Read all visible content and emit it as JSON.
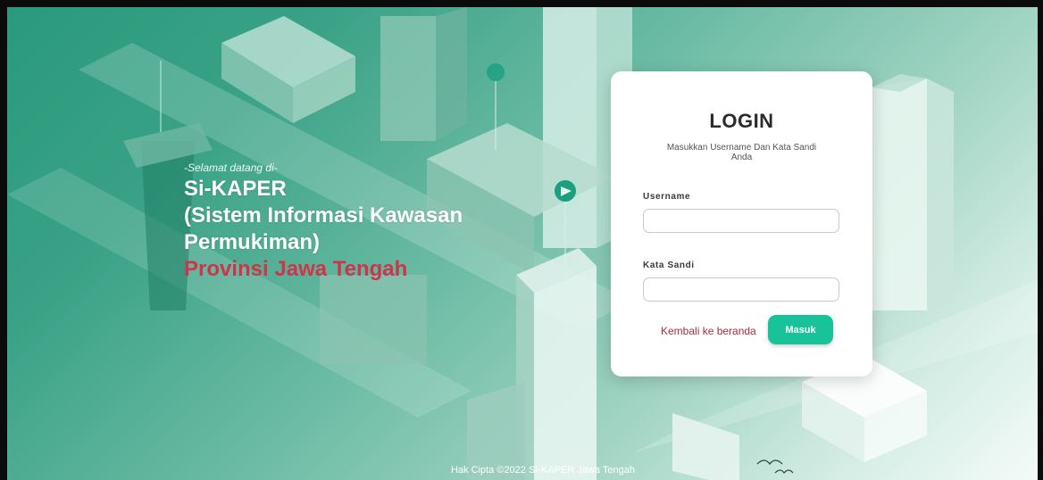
{
  "welcome": {
    "greeting": "-Selamat datang di-",
    "app_name": "Si-KAPER",
    "app_full_line1": "(Sistem Informasi Kawasan",
    "app_full_line2": "Permukiman)",
    "province": "Provinsi Jawa Tengah"
  },
  "login": {
    "title": "LOGIN",
    "subtitle": "Masukkan Username Dan Kata Sandi Anda",
    "username_label": "Username",
    "username_value": "",
    "password_label": "Kata Sandi",
    "password_value": "",
    "back_link": "Kembali ke beranda",
    "submit_label": "Masuk"
  },
  "footer": {
    "copyright": "Hak Cipta ©2022 SI-KAPER Jawa Tengah"
  },
  "colors": {
    "accent": "#19c39a",
    "province_red": "#d0344a",
    "link_red": "#b02a37",
    "background_teal": "#3aa286"
  }
}
